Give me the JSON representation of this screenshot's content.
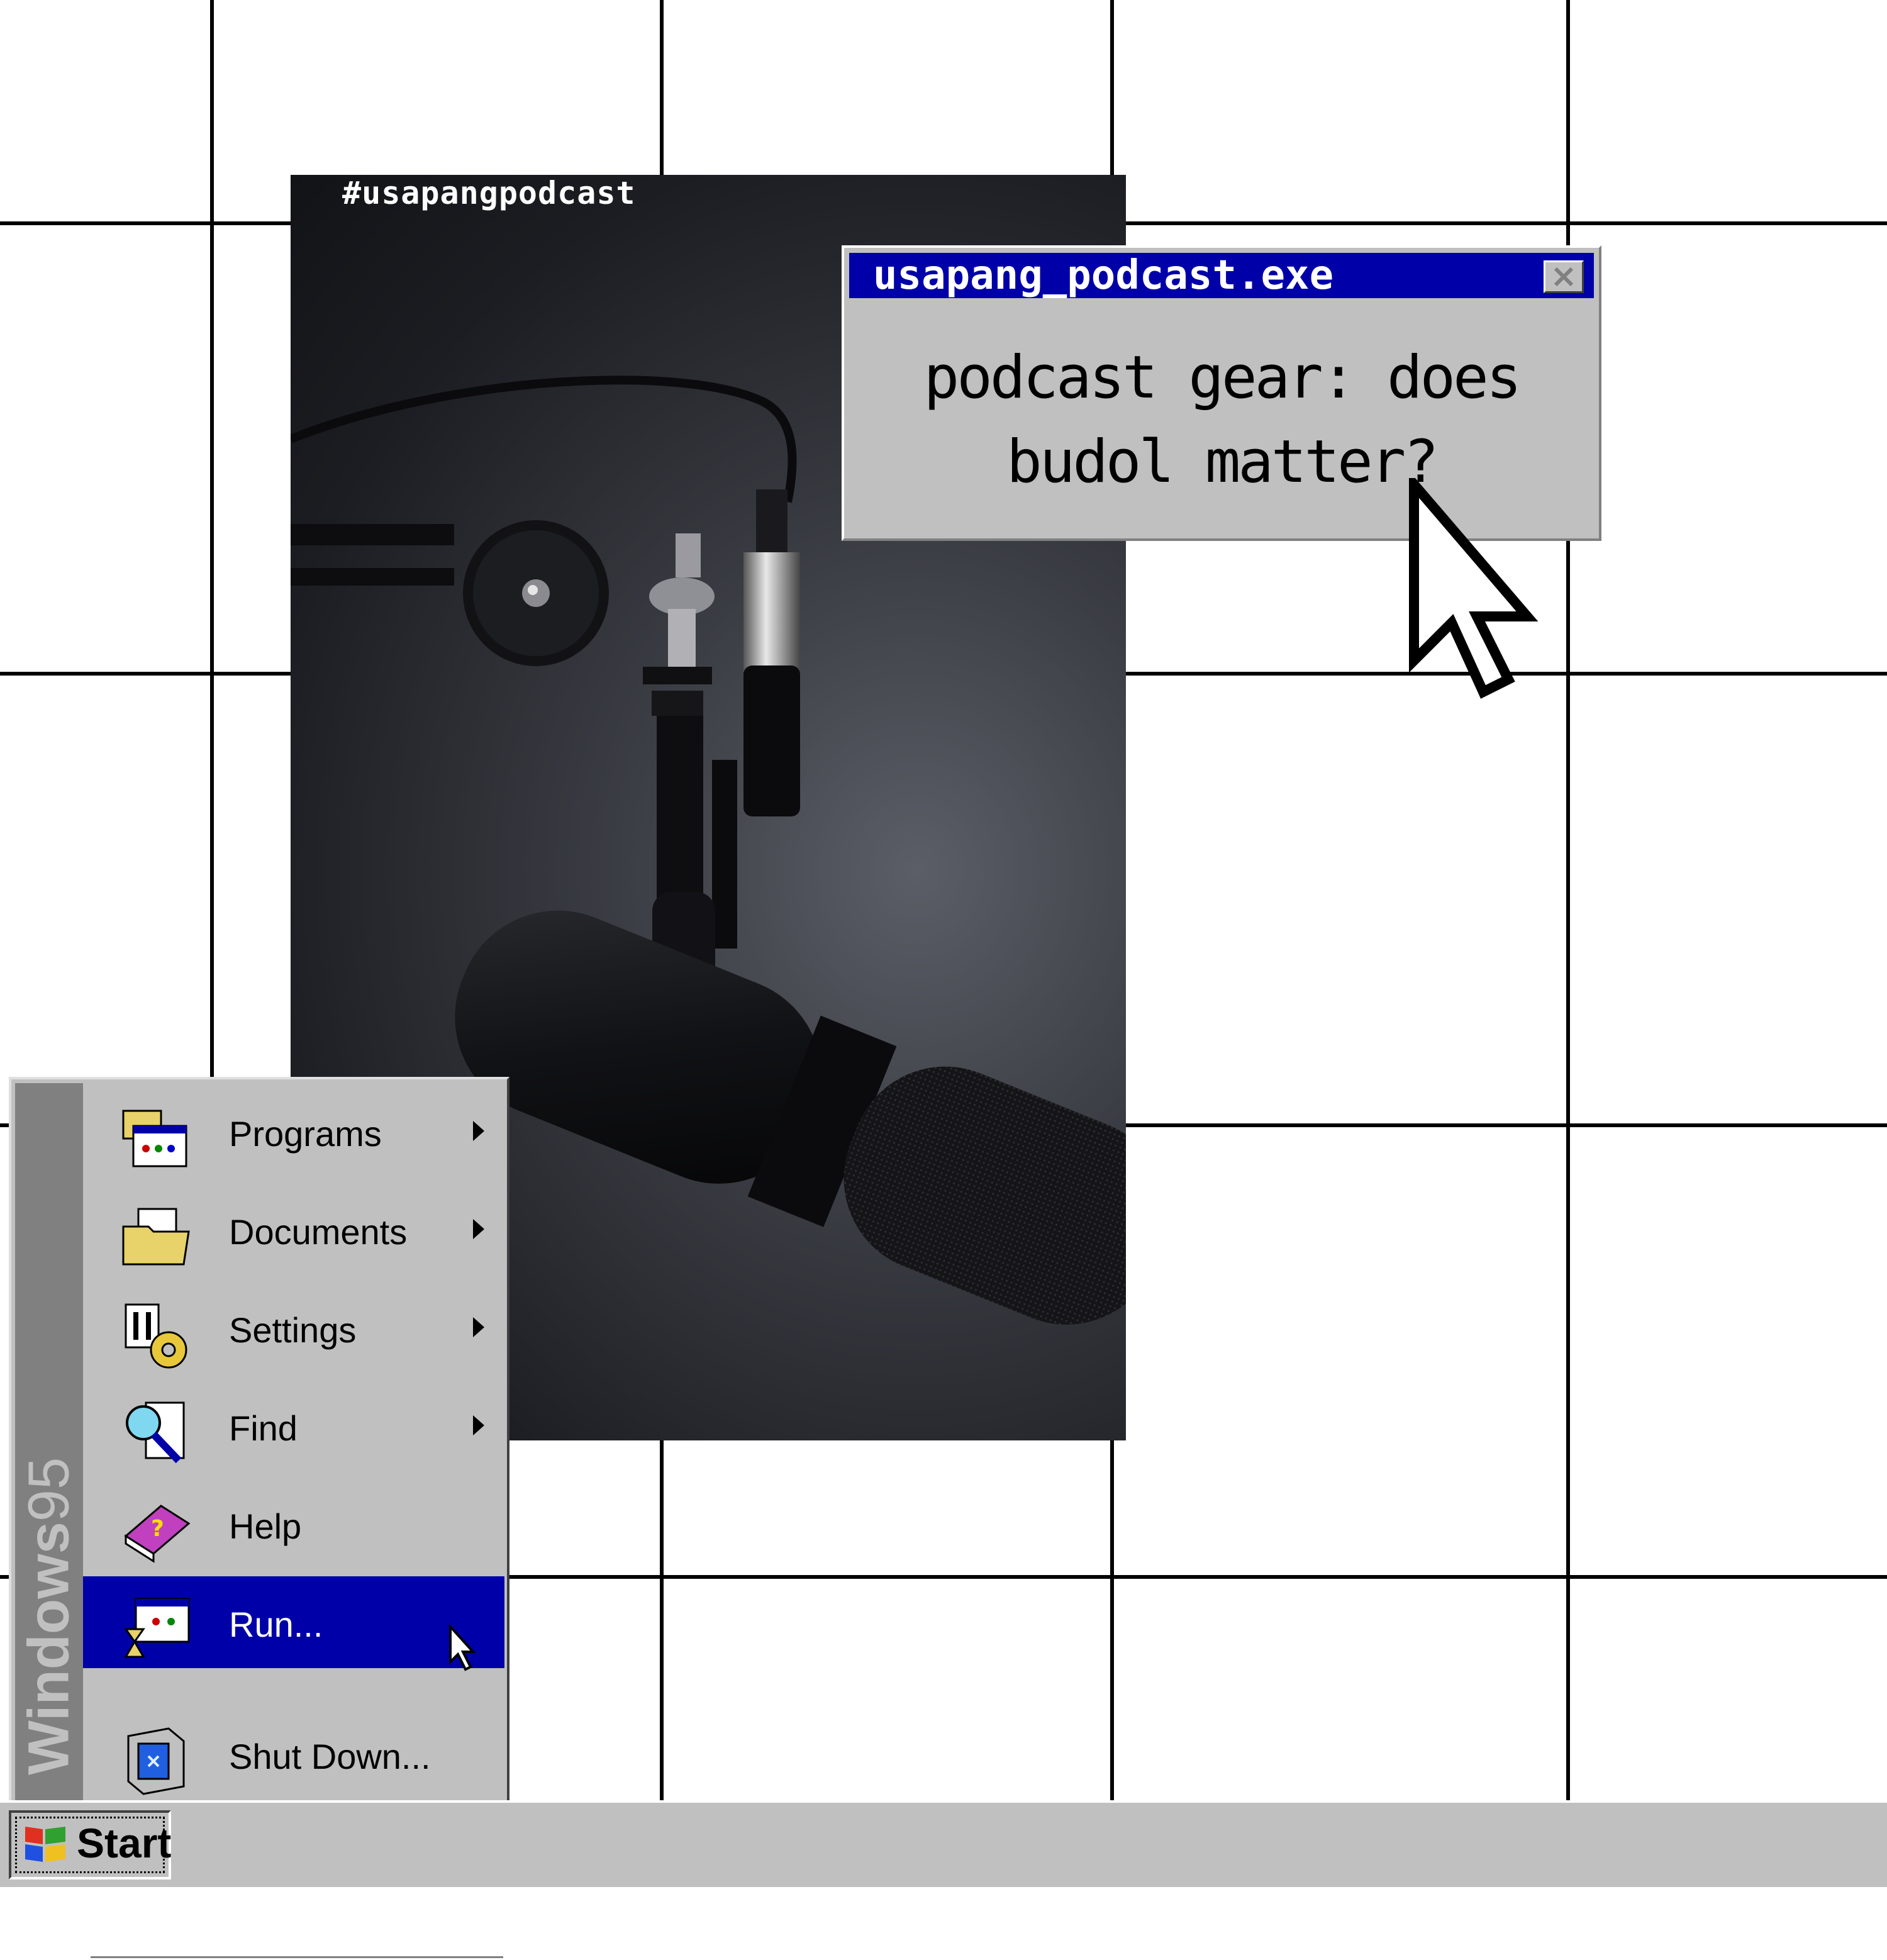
{
  "photo": {
    "hashtag": "#usapangpodcast"
  },
  "dialog": {
    "title": "usapang_podcast.exe",
    "message_line1": "podcast gear: does",
    "message_line2": "budol matter?",
    "close_icon": "close-x-icon"
  },
  "start_menu": {
    "banner": {
      "brand": "Windows",
      "version": "95"
    },
    "items": [
      {
        "label": "Programs",
        "icon": "programs-icon",
        "has_submenu": true
      },
      {
        "label": "Documents",
        "icon": "documents-folder-icon",
        "has_submenu": true
      },
      {
        "label": "Settings",
        "icon": "settings-icon",
        "has_submenu": true
      },
      {
        "label": "Find",
        "icon": "find-magnifier-icon",
        "has_submenu": true
      },
      {
        "label": "Help",
        "icon": "help-book-icon",
        "has_submenu": false
      },
      {
        "label": "Run...",
        "icon": "run-icon",
        "has_submenu": false,
        "highlighted": true
      },
      {
        "label": "Shut Down...",
        "icon": "shutdown-computer-icon",
        "has_submenu": false
      }
    ]
  },
  "taskbar": {
    "start_label": "Start"
  },
  "colors": {
    "title_bar": "#0000a8",
    "window_face": "#c0c0c0",
    "highlight": "#0000a8",
    "banner": "#808080"
  }
}
